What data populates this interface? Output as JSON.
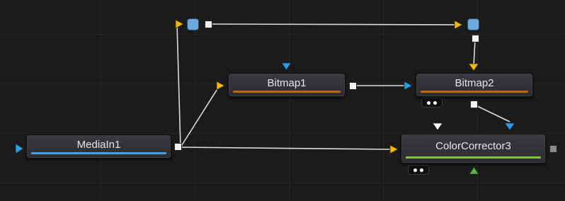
{
  "nodes": {
    "mediain1": {
      "label": "MediaIn1",
      "bar_color": "#4aa3df"
    },
    "bitmap1": {
      "label": "Bitmap1",
      "bar_color": "#b86a12"
    },
    "bitmap2": {
      "label": "Bitmap2",
      "bar_color": "#b86a12"
    },
    "colorcorrector3": {
      "label": "ColorCorrector3",
      "bar_color": "#7cc43a"
    }
  },
  "colors": {
    "background": "#1b1b1b",
    "wire": "#dcdcdc",
    "input_yellow": "#f0b914",
    "input_blue": "#2f9be0",
    "input_white": "#ffffff",
    "mask_green": "#58b54a",
    "pipe_router": "#6fa8dc"
  },
  "icons": {
    "output": "square-output-icon",
    "input": "triangle-input-icon",
    "pipe_router": "pipe-router-icon",
    "view_indicator": "view-indicator-icon"
  }
}
